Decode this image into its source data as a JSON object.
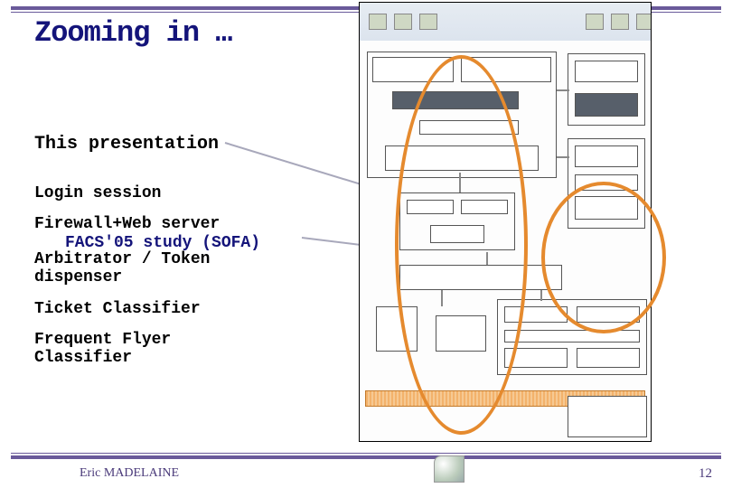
{
  "slide": {
    "title": "Zooming in …",
    "presentation_label": "This presentation",
    "login_label": "Login session",
    "firewall_label": "Firewall+Web server",
    "facs_label": "FACS'05 study (SOFA)",
    "arbitrator_label": "Arbitrator / Token",
    "dispenser_label": "dispenser",
    "ticket_label": "Ticket Classifier",
    "freq1_label": "Frequent Flyer",
    "freq2_label": "Classifier"
  },
  "footer": {
    "author": "Eric MADELAINE",
    "page_number": "12"
  }
}
